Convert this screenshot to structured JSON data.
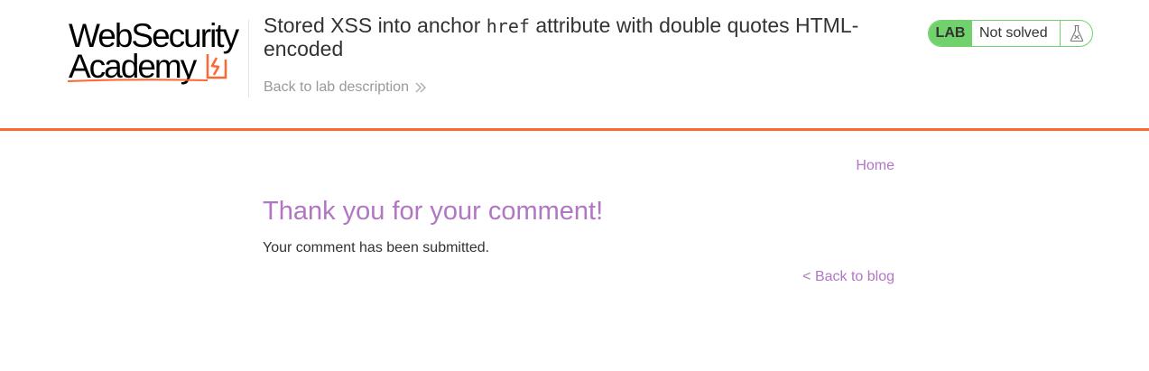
{
  "logo": {
    "line1": "WebSecurity",
    "line2": "Academy",
    "accent_color": "#ff6633"
  },
  "header": {
    "title_before": "Stored XSS into anchor ",
    "title_code": "href",
    "title_after": " attribute with double quotes HTML-encoded",
    "back_link": "Back to lab description",
    "back_icon": "double-chevron-right-icon"
  },
  "lab_status": {
    "badge": "LAB",
    "status": "Not solved",
    "icon": "flask-icon",
    "badge_color": "#70d16d"
  },
  "nav": {
    "home": "Home"
  },
  "main": {
    "heading": "Thank you for your comment!",
    "message": "Your comment has been submitted.",
    "back_to_blog": "< Back to blog",
    "link_color": "#b176c4"
  }
}
